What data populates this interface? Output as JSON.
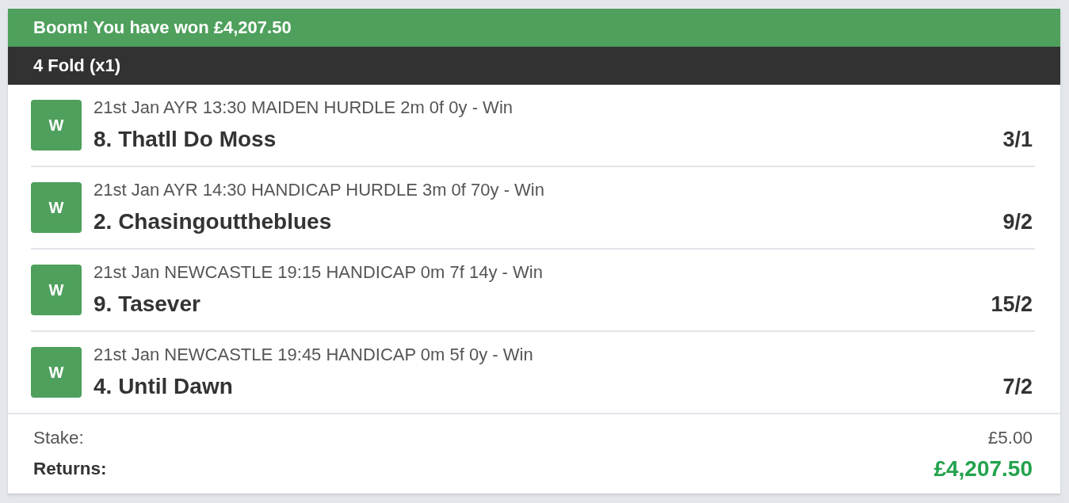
{
  "banner": {
    "title": "Boom! You have won £4,207.50"
  },
  "bet_header": {
    "title": "4 Fold (x1)"
  },
  "selections": [
    {
      "result": "W",
      "event": "21st Jan AYR 13:30 MAIDEN HURDLE 2m 0f 0y - Win",
      "runner": "8. Thatll Do Moss",
      "odds": "3/1"
    },
    {
      "result": "W",
      "event": "21st Jan AYR 14:30 HANDICAP HURDLE 3m 0f 70y - Win",
      "runner": "2. Chasingouttheblues",
      "odds": "9/2"
    },
    {
      "result": "W",
      "event": "21st Jan NEWCASTLE 19:15 HANDICAP 0m 7f 14y - Win",
      "runner": "9. Tasever",
      "odds": "15/2"
    },
    {
      "result": "W",
      "event": "21st Jan NEWCASTLE 19:45 HANDICAP 0m 5f 0y - Win",
      "runner": "4. Until Dawn",
      "odds": "7/2"
    }
  ],
  "summary": {
    "stake_label": "Stake:",
    "stake": "£5.00",
    "returns_label": "Returns:",
    "returns": "£4,207.50"
  }
}
